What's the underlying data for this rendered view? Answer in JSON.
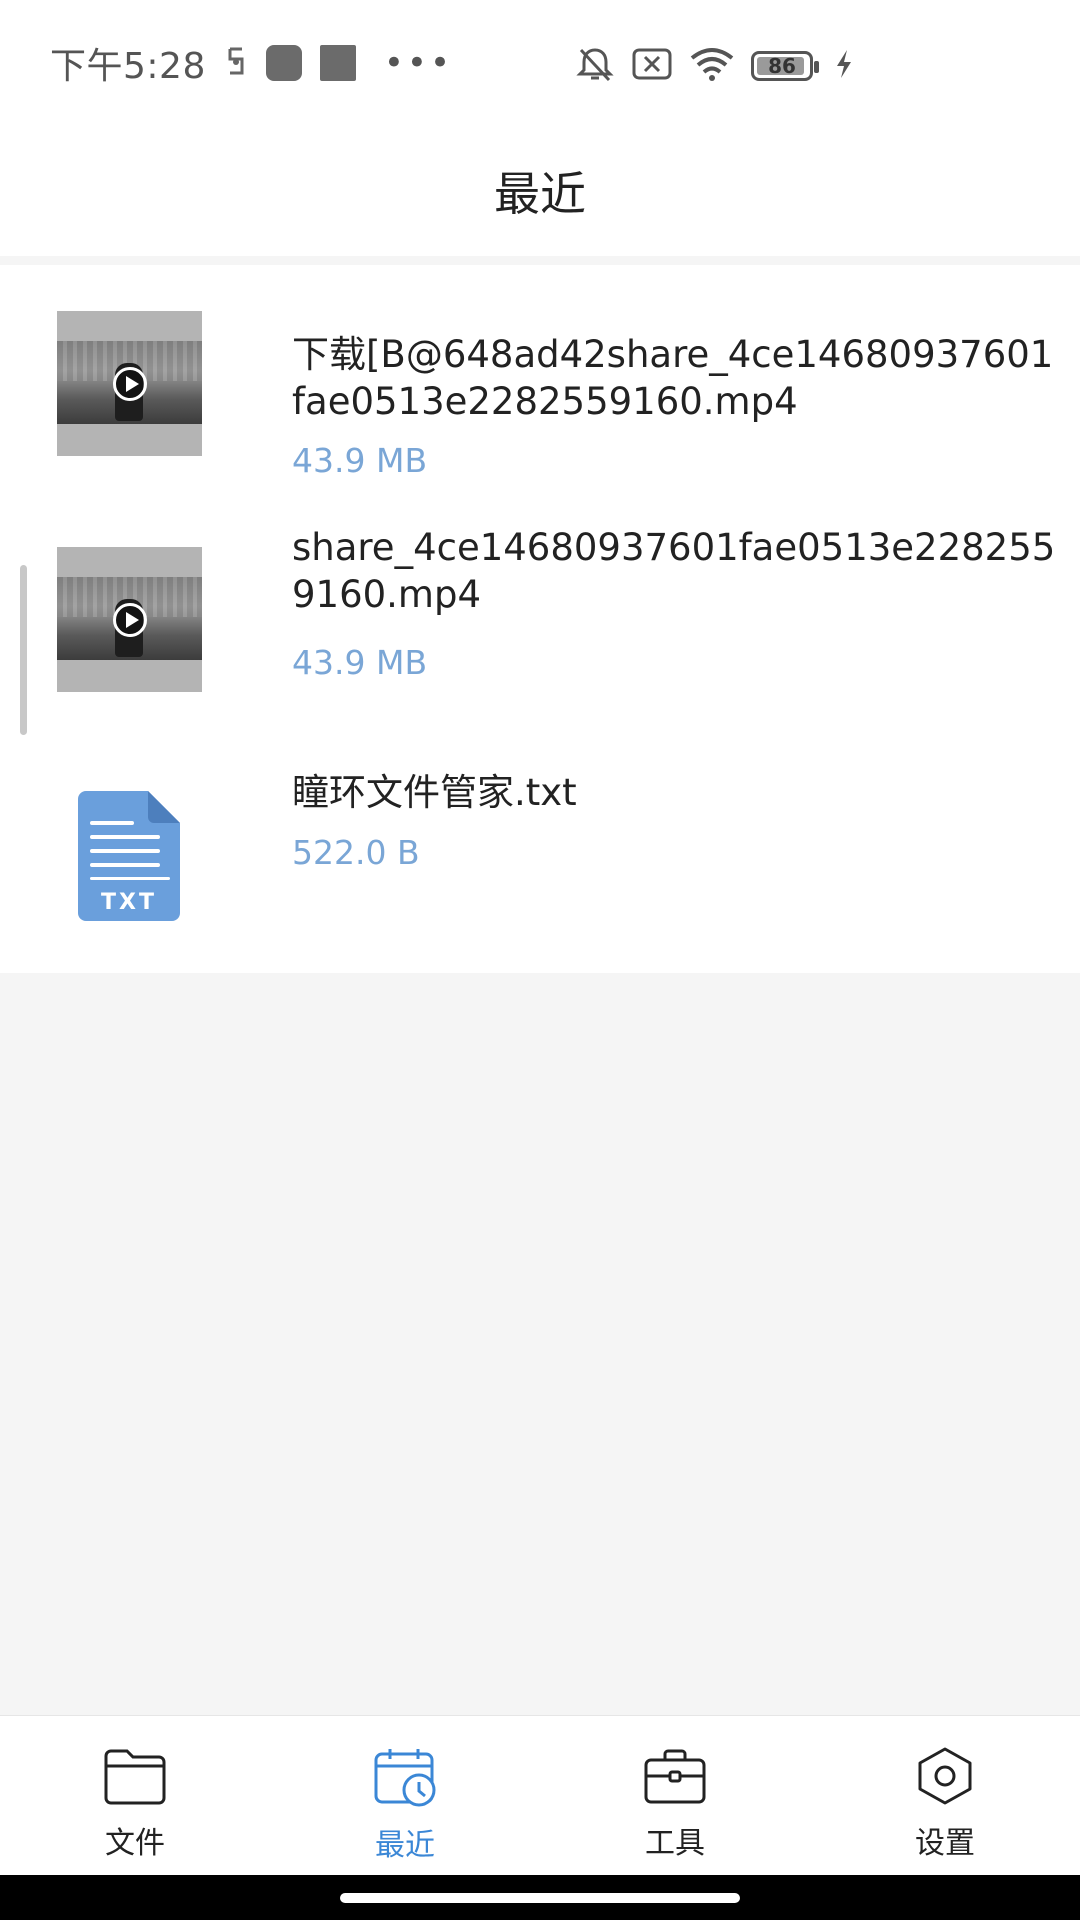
{
  "status_bar": {
    "time": "下午5:28",
    "battery_level": "86"
  },
  "header": {
    "title": "最近"
  },
  "files": [
    {
      "name": "下载[B@648ad42share_4ce14680937601fae0513e2282559160.mp4",
      "size": "43.9 MB",
      "type": "video"
    },
    {
      "name": "share_4ce14680937601fae0513e2282559160.mp4",
      "size": "43.9 MB",
      "type": "video"
    },
    {
      "name": "瞳环文件管家.txt",
      "size": "522.0 B",
      "type": "txt"
    }
  ],
  "txt_icon_label": "TXT",
  "bottom_nav": {
    "items": [
      {
        "label": "文件",
        "icon": "folder-icon",
        "active": false
      },
      {
        "label": "最近",
        "icon": "calendar-clock-icon",
        "active": true
      },
      {
        "label": "工具",
        "icon": "toolbox-icon",
        "active": false
      },
      {
        "label": "设置",
        "icon": "gear-icon",
        "active": false
      }
    ]
  },
  "colors": {
    "accent": "#3b87d6",
    "size_text": "#7aa6d6",
    "txt_icon": "#6a9fdc"
  }
}
